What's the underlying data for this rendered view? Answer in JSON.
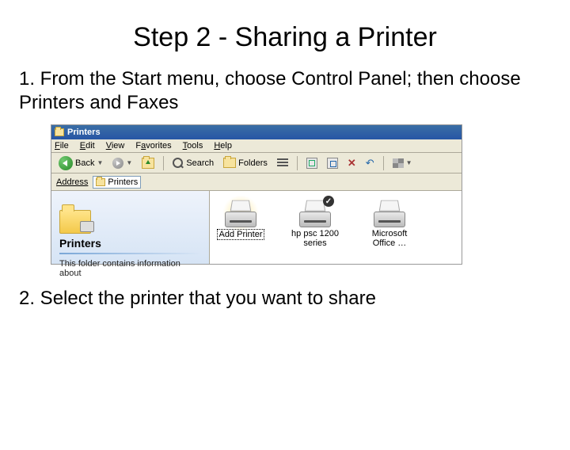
{
  "title": "Step 2 - Sharing a Printer",
  "step1": "1. From the Start menu, choose Control Panel; then choose Printers and Faxes",
  "step2": "2. Select the printer that you want to share",
  "window": {
    "title": "Printers",
    "menu": {
      "file": "File",
      "edit": "Edit",
      "view": "View",
      "favorites": "Favorites",
      "tools": "Tools",
      "help": "Help"
    },
    "toolbar": {
      "back": "Back",
      "search": "Search",
      "folders": "Folders"
    },
    "address": {
      "label": "Address",
      "value": "Printers"
    },
    "leftpane": {
      "heading": "Printers",
      "body": "This folder contains information about"
    },
    "items": {
      "add": "Add Printer",
      "hp": "hp psc 1200 series",
      "ms": "Microsoft Office …"
    }
  }
}
